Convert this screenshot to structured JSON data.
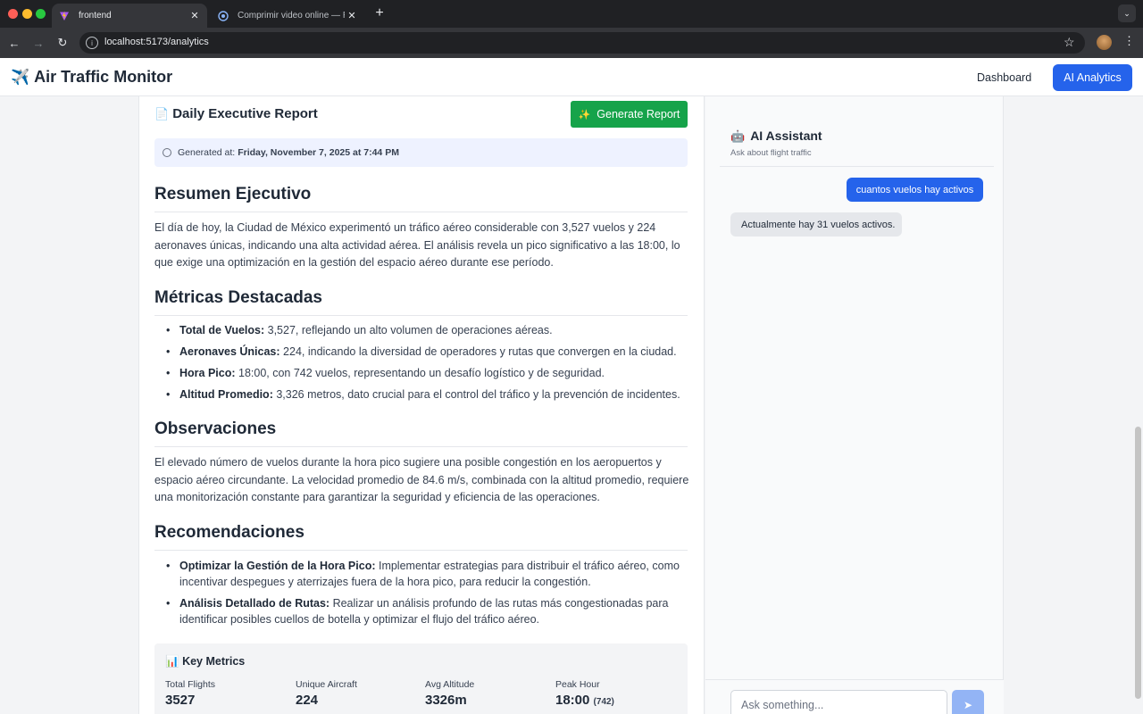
{
  "browser": {
    "tabs": [
      {
        "title": "frontend",
        "active": true,
        "favicon": "vite-icon"
      },
      {
        "title": "Comprimir video online — Re",
        "active": false,
        "favicon": "compress-icon"
      }
    ],
    "url": "localhost:5173/analytics"
  },
  "header": {
    "brand": "Air Traffic Monitor",
    "brand_icon": "✈️",
    "nav": {
      "dashboard": "Dashboard",
      "ai_analytics": "AI Analytics"
    },
    "accent": "#2563eb"
  },
  "report": {
    "icon": "📄",
    "title": "Daily Executive Report",
    "generate_icon": "✨",
    "generate_button": "Generate Report",
    "generated_label": "Generated at:",
    "generated_value": "Friday, November 7, 2025 at 7:44 PM",
    "sections": {
      "summary": {
        "heading": "Resumen Ejecutivo",
        "text": "El día de hoy, la Ciudad de México experimentó un tráfico aéreo considerable con 3,527 vuelos y 224 aeronaves únicas, indicando una alta actividad aérea. El análisis revela un pico significativo a las 18:00, lo que exige una optimización en la gestión del espacio aéreo durante ese período."
      },
      "metrics": {
        "heading": "Métricas Destacadas",
        "items": [
          {
            "label": "Total de Vuelos:",
            "text": " 3,527, reflejando un alto volumen de operaciones aéreas."
          },
          {
            "label": "Aeronaves Únicas:",
            "text": " 224, indicando la diversidad de operadores y rutas que convergen en la ciudad."
          },
          {
            "label": "Hora Pico:",
            "text": " 18:00, con 742 vuelos, representando un desafío logístico y de seguridad."
          },
          {
            "label": "Altitud Promedio:",
            "text": " 3,326 metros, dato crucial para el control del tráfico y la prevención de incidentes."
          }
        ]
      },
      "observations": {
        "heading": "Observaciones",
        "text": "El elevado número de vuelos durante la hora pico sugiere una posible congestión en los aeropuertos y espacio aéreo circundante. La velocidad promedio de 84.6 m/s, combinada con la altitud promedio, requiere una monitorización constante para garantizar la seguridad y eficiencia de las operaciones."
      },
      "recommendations": {
        "heading": "Recomendaciones",
        "items": [
          {
            "label": "Optimizar la Gestión de la Hora Pico:",
            "text": " Implementar estrategias para distribuir el tráfico aéreo, como incentivar despegues y aterrizajes fuera de la hora pico, para reducir la congestión."
          },
          {
            "label": "Análisis Detallado de Rutas:",
            "text": " Realizar un análisis profundo de las rutas más congestionadas para identificar posibles cuellos de botella y optimizar el flujo del tráfico aéreo."
          }
        ]
      }
    },
    "key_metrics": {
      "icon": "📊",
      "title": "Key Metrics",
      "items": [
        {
          "label": "Total Flights",
          "value": "3527",
          "extra": ""
        },
        {
          "label": "Unique Aircraft",
          "value": "224",
          "extra": ""
        },
        {
          "label": "Avg Altitude",
          "value": "3326m",
          "extra": ""
        },
        {
          "label": "Peak Hour",
          "value": "18:00",
          "extra": "(742)"
        }
      ]
    }
  },
  "assistant": {
    "icon": "🤖",
    "title": "AI Assistant",
    "subtitle": "Ask about flight traffic",
    "messages": [
      {
        "role": "user",
        "text": "cuantos vuelos hay activos"
      },
      {
        "role": "bot",
        "text": "Actualmente hay 31 vuelos activos."
      }
    ],
    "input_placeholder": "Ask something...",
    "send_icon": "➤"
  }
}
